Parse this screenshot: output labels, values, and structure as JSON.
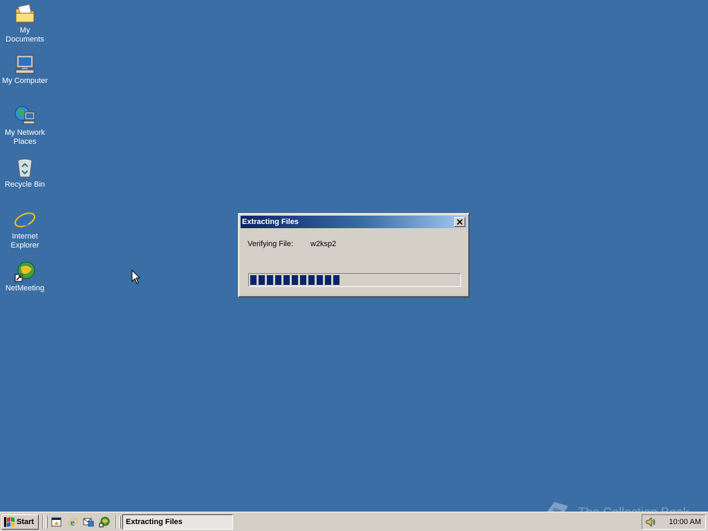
{
  "desktop": {
    "icons": [
      {
        "label": "My Documents",
        "icon": "my-documents-icon"
      },
      {
        "label": "My Computer",
        "icon": "my-computer-icon"
      },
      {
        "label": "My Network Places",
        "icon": "network-places-icon"
      },
      {
        "label": "Recycle Bin",
        "icon": "recycle-bin-icon"
      },
      {
        "label": "Internet Explorer",
        "icon": "internet-explorer-icon"
      },
      {
        "label": "NetMeeting",
        "icon": "netmeeting-icon"
      }
    ],
    "background_color": "#3a6ea5"
  },
  "dialog": {
    "title": "Extracting Files",
    "close_label": "✕",
    "verify_label": "Verifying File:",
    "verify_value": "w2ksp2",
    "progress_fraction": 0.43
  },
  "taskbar": {
    "start_label": "Start",
    "quick_launch": [
      "show-desktop-icon",
      "internet-explorer-icon",
      "outlook-express-icon",
      "netmeeting-icon"
    ],
    "task_label": "Extracting Files",
    "clock": "10:00 AM"
  },
  "watermark": {
    "text": "The Collection Book"
  },
  "colors": {
    "titlebar_start": "#0a246a",
    "titlebar_end": "#a6caf0",
    "progress": "#0a246a",
    "face": "#d4d0c8"
  }
}
